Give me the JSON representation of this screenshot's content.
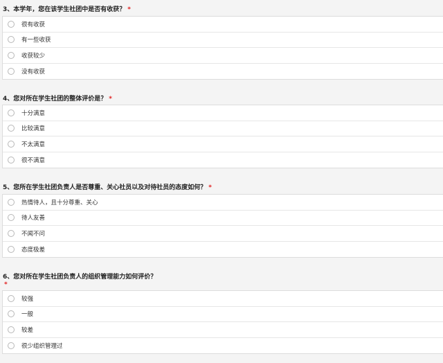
{
  "questions": [
    {
      "title": "3、本学年，您在该学生社团中是否有收获？",
      "required_mark": "*",
      "options": [
        "很有收获",
        "有一些收获",
        "收获较少",
        "没有收获"
      ]
    },
    {
      "title": "4、您对所在学生社团的整体评价是？",
      "required_mark": "*",
      "options": [
        "十分满意",
        "比较满意",
        "不太满意",
        "很不满意"
      ]
    },
    {
      "title": "5、您所在学生社团负责人是否尊重、关心社员以及对待社员的态度如何？",
      "required_mark": "*",
      "options": [
        "热情待人，且十分尊重、关心",
        "待人友善",
        "不闻不问",
        "态度极差"
      ]
    },
    {
      "title": "6、您对所在学生社团负责人的组织管理能力如何评价？",
      "required_mark": "*",
      "options": [
        "较强",
        "一般",
        "较差",
        "很少组织管理过"
      ]
    }
  ]
}
